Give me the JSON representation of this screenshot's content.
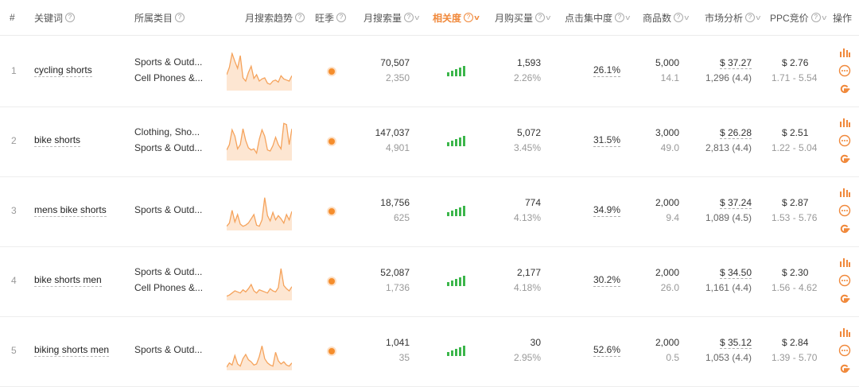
{
  "headers": {
    "idx": "#",
    "keyword": "关键词",
    "category": "所属类目",
    "trend": "月搜索趋势",
    "season": "旺季",
    "monthly_search": "月搜索量",
    "relevance": "相关度",
    "monthly_purchase": "月购买量",
    "click_concentration": "点击集中度",
    "products": "商品数",
    "market": "市场分析",
    "ppc": "PPC竞价",
    "ops": "操作"
  },
  "colors": {
    "accent": "#f0883a",
    "trend_line": "#f5a35c",
    "trend_fill": "#fde6d2",
    "relevance_bar": "#3cb64b",
    "season_dot": "#f58d2c"
  },
  "icons": {
    "chart": "bar-chart-icon",
    "more": "more-icon",
    "google": "google-icon"
  },
  "rows": [
    {
      "idx": "1",
      "keyword": "cycling shorts",
      "categories": [
        "Sports & Outd...",
        "Cell Phones &..."
      ],
      "trend": [
        30,
        44,
        70,
        55,
        42,
        66,
        24,
        18,
        34,
        46,
        23,
        30,
        18,
        22,
        24,
        14,
        12,
        18,
        20,
        16,
        28,
        22,
        20,
        18,
        28
      ],
      "search_volume": "70,507",
      "search_sub": "2,350",
      "purchase": "1,593",
      "purchase_rate": "2.26%",
      "click_conc": "26.1%",
      "products": "5,000",
      "products_sub": "14.1",
      "price": "$ 37.27",
      "reviews": "1,296 (4.4)",
      "ppc": "$ 2.76",
      "ppc_range": "1.71 - 5.54"
    },
    {
      "idx": "2",
      "keyword": "bike shorts",
      "categories": [
        "Clothing, Sho...",
        "Sports & Outd..."
      ],
      "trend": [
        20,
        30,
        58,
        46,
        22,
        30,
        60,
        38,
        24,
        20,
        22,
        14,
        40,
        58,
        46,
        20,
        18,
        28,
        44,
        30,
        22,
        70,
        68,
        30,
        60
      ],
      "search_volume": "147,037",
      "search_sub": "4,901",
      "purchase": "5,072",
      "purchase_rate": "3.45%",
      "click_conc": "31.5%",
      "products": "3,000",
      "products_sub": "49.0",
      "price": "$ 26.28",
      "reviews": "2,813 (4.4)",
      "ppc": "$ 2.51",
      "ppc_range": "1.22 - 5.04"
    },
    {
      "idx": "3",
      "keyword": "mens bike shorts",
      "categories": [
        "Sports & Outd..."
      ],
      "trend": [
        8,
        14,
        38,
        16,
        30,
        12,
        8,
        10,
        14,
        22,
        30,
        10,
        8,
        20,
        62,
        28,
        18,
        34,
        20,
        28,
        22,
        14,
        30,
        20,
        36
      ],
      "search_volume": "18,756",
      "search_sub": "625",
      "purchase": "774",
      "purchase_rate": "4.13%",
      "click_conc": "34.9%",
      "products": "2,000",
      "products_sub": "9.4",
      "price": "$ 37.24",
      "reviews": "1,089 (4.5)",
      "ppc": "$ 2.87",
      "ppc_range": "1.53 - 5.76"
    },
    {
      "idx": "4",
      "keyword": "bike shorts men",
      "categories": [
        "Sports & Outd...",
        "Cell Phones &..."
      ],
      "trend": [
        8,
        10,
        14,
        18,
        16,
        14,
        20,
        16,
        22,
        30,
        18,
        14,
        20,
        18,
        16,
        14,
        22,
        18,
        16,
        24,
        60,
        28,
        22,
        18,
        26
      ],
      "search_volume": "52,087",
      "search_sub": "1,736",
      "purchase": "2,177",
      "purchase_rate": "4.18%",
      "click_conc": "30.2%",
      "products": "2,000",
      "products_sub": "26.0",
      "price": "$ 34.50",
      "reviews": "1,161 (4.4)",
      "ppc": "$ 2.30",
      "ppc_range": "1.56 - 4.62"
    },
    {
      "idx": "5",
      "keyword": "biking shorts men",
      "categories": [
        "Sports & Outd..."
      ],
      "trend": [
        6,
        14,
        10,
        28,
        12,
        8,
        22,
        30,
        20,
        16,
        10,
        12,
        26,
        46,
        22,
        14,
        10,
        8,
        34,
        18,
        12,
        16,
        10,
        8,
        14
      ],
      "search_volume": "1,041",
      "search_sub": "35",
      "purchase": "30",
      "purchase_rate": "2.95%",
      "click_conc": "52.6%",
      "products": "2,000",
      "products_sub": "0.5",
      "price": "$ 35.12",
      "reviews": "1,053 (4.4)",
      "ppc": "$ 2.84",
      "ppc_range": "1.39 - 5.70"
    }
  ]
}
